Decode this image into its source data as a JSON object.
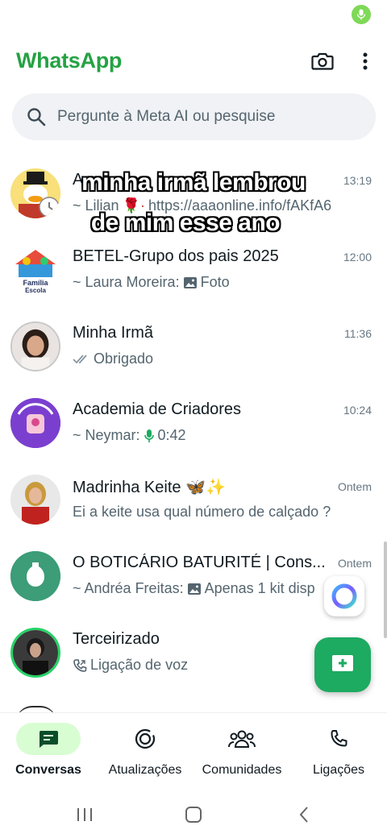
{
  "app": {
    "title": "WhatsApp"
  },
  "colors": {
    "brand_green": "#25a244",
    "fab_green": "#1daa61",
    "active_tab_bg": "#d8fdd2"
  },
  "search": {
    "placeholder": "Pergunte à Meta AI ou pesquise"
  },
  "caption": {
    "line1": "minha irmã lembrou",
    "line2": "de mim esse ano"
  },
  "chats": [
    {
      "name": "A",
      "time": "13:19",
      "sender": "~ Lilian",
      "message": "https://aaaonline.info/fAKfA6",
      "avatar": "cartoon-duck-avatar"
    },
    {
      "name": "BETEL-Grupo dos pais 2025",
      "time": "12:00",
      "sender": "~ Laura Moreira:",
      "message": "Foto",
      "avatar": "familia-escola-avatar"
    },
    {
      "name": "Minha Irmã",
      "time": "11:36",
      "sender": "",
      "message": "Obrigado",
      "avatar": "woman-photo-avatar"
    },
    {
      "name": "Academia de Criadores",
      "time": "10:24",
      "sender": "~ Neymar:",
      "message": "0:42",
      "avatar": "academia-logo-avatar"
    },
    {
      "name": "Madrinha Keite 🦋✨",
      "time": "Ontem",
      "sender": "",
      "message": "Ei a keite usa qual número de calçado ?",
      "avatar": "woman-red-dress-avatar"
    },
    {
      "name": "O BOTICÁRIO BATURITÉ | Cons...",
      "time": "Ontem",
      "sender": "~ Andréa Freitas:",
      "message": "Apenas 1 kit disp",
      "avatar": "boticario-logo-avatar"
    },
    {
      "name": "Terceirizado",
      "time": "",
      "sender": "",
      "message": "Ligação de voz",
      "avatar": "man-photo-avatar"
    }
  ],
  "nav": [
    {
      "label": "Conversas",
      "icon": "chat-icon",
      "active": true
    },
    {
      "label": "Atualizações",
      "icon": "status-icon",
      "active": false
    },
    {
      "label": "Comunidades",
      "icon": "communities-icon",
      "active": false
    },
    {
      "label": "Ligações",
      "icon": "phone-icon",
      "active": false
    }
  ]
}
